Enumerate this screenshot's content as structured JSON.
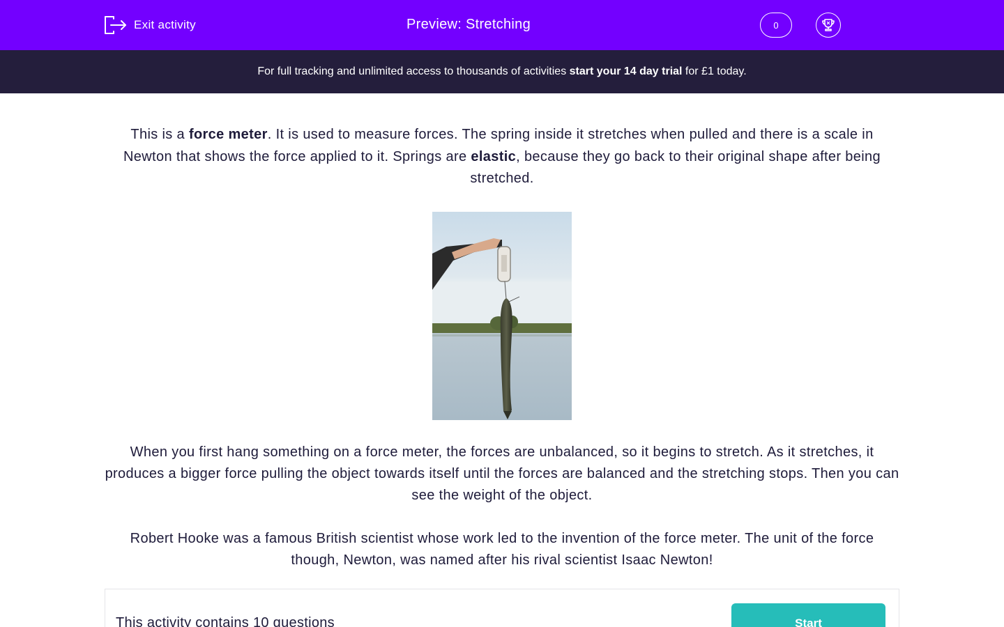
{
  "topbar": {
    "exit_label": "Exit activity",
    "title": "Preview: Stretching",
    "score": "0",
    "background": "#7300ff"
  },
  "banner": {
    "text_before": "For full tracking and unlimited access to thousands of activities ",
    "text_bold": "start your 14 day trial",
    "text_after": " for £1 today.",
    "background": "#241e3c"
  },
  "intro": {
    "t1": "This is a ",
    "b1": "force meter",
    "t2": ". It is used to measure forces. The spring inside it stretches when pulled and there is a scale in Newton that shows the force applied to it. Springs are ",
    "b2": "elastic",
    "t3": ", because they go back to their original shape after being stretched."
  },
  "image": {
    "description_icon": "fish-on-force-meter-photo"
  },
  "paragraph2": "When you first hang something on a force meter, the forces are unbalanced, so it begins to stretch. As it stretches, it produces a bigger force pulling the object towards itself until the forces are balanced and the stretching stops. Then you can see the weight of the object.",
  "paragraph3": "Robert Hooke was a famous British scientist whose work led to the invention of the force meter. The unit of the force though, Newton, was named after his rival scientist Isaac Newton!",
  "card": {
    "summary": "This activity contains 10 questions",
    "start_label": "Start",
    "start_color": "#26bdb9"
  }
}
